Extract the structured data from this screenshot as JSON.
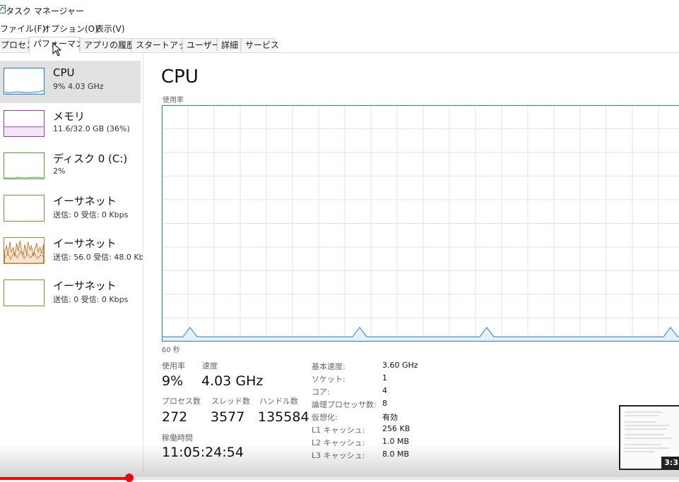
{
  "window": {
    "title": "タスク マネージャー"
  },
  "menu": [
    "ファイル(F)",
    "オプション(O)",
    "表示(V)"
  ],
  "tabs": [
    "プロセス",
    "パフォーマンス",
    "アプリの履歴",
    "スタートアップ",
    "ユーザー",
    "詳細",
    "サービス"
  ],
  "active_tab": "パフォーマンス",
  "sidebar": {
    "items": [
      {
        "name": "CPU",
        "sub": "9%  4.03 GHz",
        "color": "#1c7ed6"
      },
      {
        "name": "メモリ",
        "sub": "11.6/32.0 GB (36%)",
        "color": "#9b3bb5"
      },
      {
        "name": "ディスク 0 (C:)",
        "sub": "2%",
        "color": "#4da832"
      },
      {
        "name": "イーサネット",
        "sub": "送信: 0  受信: 0 Kbps",
        "color": "#c47a2c"
      },
      {
        "name": "イーサネット",
        "sub": "送信: 56.0  受信: 48.0 Kb",
        "color": "#c47a2c"
      },
      {
        "name": "イーサネット",
        "sub": "送信: 0  受信: 0 Kbps",
        "color": "#c47a2c"
      }
    ]
  },
  "main": {
    "title": "CPU",
    "usage_label": "使用率",
    "time_label": "60 秒",
    "stats": {
      "usage_label": "使用率",
      "usage_value": "9%",
      "speed_label": "速度",
      "speed_value": "4.03 GHz",
      "processes_label": "プロセス数",
      "processes_value": "272",
      "threads_label": "スレッド数",
      "threads_value": "3577",
      "handles_label": "ハンドル数",
      "handles_value": "135584",
      "uptime_label": "稼働時間",
      "uptime_value": "11:05:24:54"
    },
    "specs": [
      {
        "label": "基本速度:",
        "value": "3.60 GHz"
      },
      {
        "label": "ソケット:",
        "value": "1"
      },
      {
        "label": "コア:",
        "value": "4"
      },
      {
        "label": "論理プロセッサ数:",
        "value": "8"
      },
      {
        "label": "仮想化:",
        "value": "有効"
      },
      {
        "label": "L1 キャッシュ:",
        "value": "256 KB"
      },
      {
        "label": "L2 キャッシュ:",
        "value": "1.0 MB"
      },
      {
        "label": "L3 キャッシュ:",
        "value": "8.0 MB"
      }
    ]
  },
  "cpu_graph": {
    "y_range": [
      0,
      100
    ],
    "values": [
      2,
      2,
      2,
      2,
      6,
      2,
      2,
      2,
      2,
      2,
      2,
      2,
      2,
      2,
      2,
      2,
      2,
      2,
      2,
      2,
      2,
      2,
      2,
      2,
      2,
      2,
      2,
      2,
      6,
      2,
      2,
      2,
      2,
      2,
      2,
      2,
      2,
      2,
      2,
      2,
      2,
      2,
      2,
      2,
      2,
      2,
      6,
      2,
      2,
      2,
      2,
      2,
      2,
      2,
      2,
      2,
      2,
      2,
      2,
      2,
      2,
      2,
      2,
      2,
      2,
      2,
      2,
      2,
      2,
      2,
      2,
      2,
      6,
      2,
      2
    ]
  },
  "colors": {
    "cpu": "#1c7ed6",
    "grid": "#d8e6f2",
    "graph_fill": "#e8f1f9"
  },
  "video_overlay": {
    "timestamp": "3:3",
    "progress": 0.19
  }
}
